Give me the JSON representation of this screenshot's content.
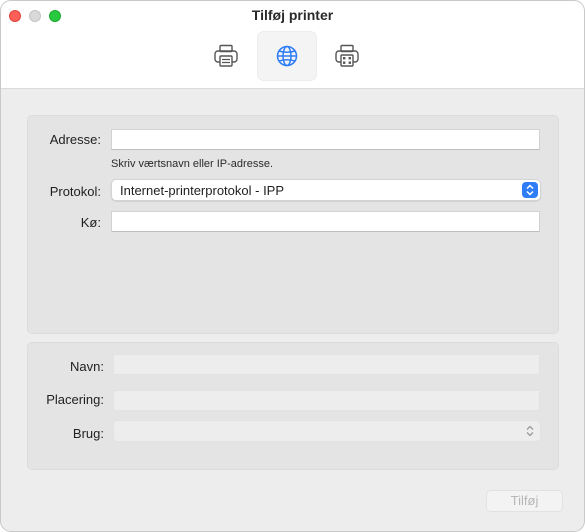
{
  "window": {
    "title": "Tilføj printer"
  },
  "toolbar": {
    "items": [
      {
        "icon": "printer-icon",
        "selected": false
      },
      {
        "icon": "globe-icon",
        "selected": true
      },
      {
        "icon": "printer-grid-icon",
        "selected": false
      }
    ]
  },
  "connection": {
    "address_label": "Adresse:",
    "address_value": "",
    "address_hint": "Skriv værtsnavn eller IP-adresse.",
    "protocol_label": "Protokol:",
    "protocol_value": "Internet-printerprotokol - IPP",
    "queue_label": "Kø:",
    "queue_value": ""
  },
  "details": {
    "name_label": "Navn:",
    "name_value": "",
    "location_label": "Placering:",
    "location_value": "",
    "use_label": "Brug:",
    "use_value": ""
  },
  "footer": {
    "add_label": "Tilføj"
  },
  "colors": {
    "accent": "#2e7cf6",
    "close": "#fe5f57",
    "zoom": "#28c840"
  }
}
